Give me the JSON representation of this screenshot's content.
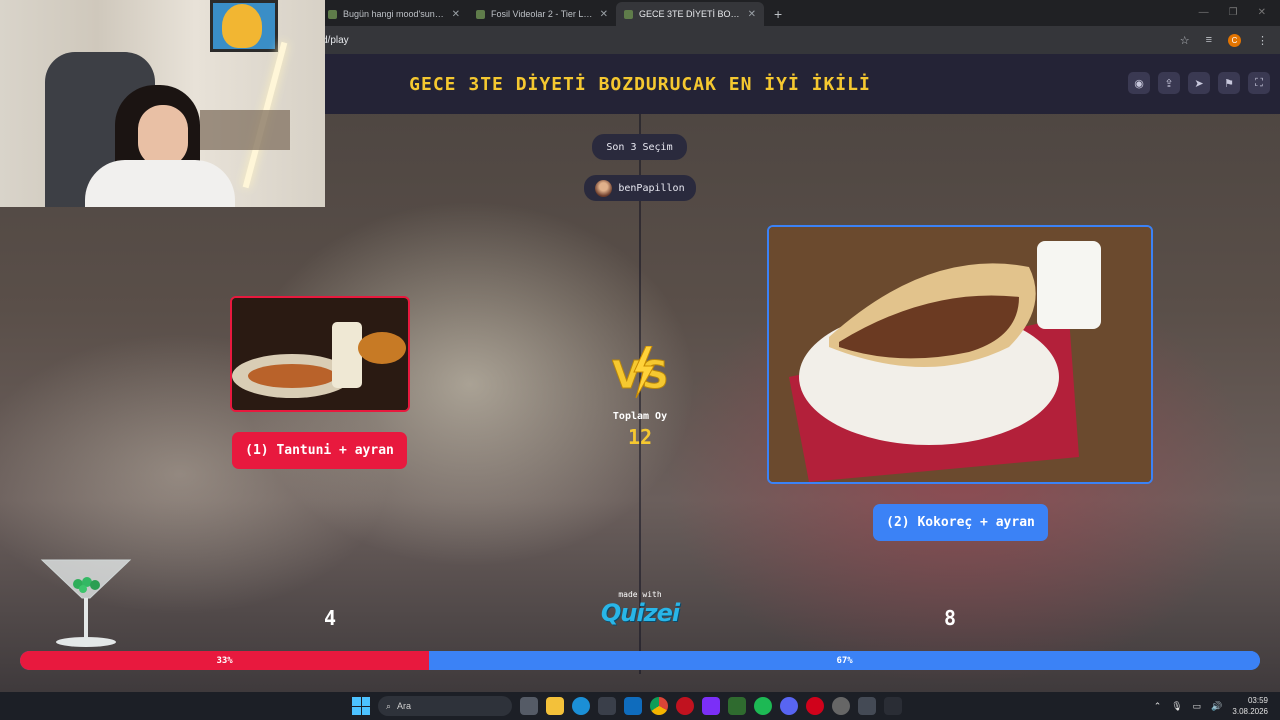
{
  "browser": {
    "tabs": [
      {
        "label": "Bugün hangi mood'sun? - Tier",
        "active": false
      },
      {
        "label": "Fosil Videolar 2 - Tier List | Kör",
        "active": false
      },
      {
        "label": "GECE 3TE DİYETİ BOZDURUCAK",
        "active": true
      }
    ],
    "new_tab": "+",
    "address": "d/play",
    "profile_initial": "C"
  },
  "quiz": {
    "title": "GECE 3TE DİYETİ BOZDURUCAK EN İYİ İKİLİ",
    "recent_label": "Son 3 Seçim",
    "recent_user": "benPapillon",
    "option_left": "(1) Tantuni + ayran",
    "option_right": "(2) Kokoreç + ayran",
    "total_label": "Toplam Oy",
    "total_votes": "12",
    "votes_left": "4",
    "votes_right": "8",
    "percent_left": "33%",
    "percent_right": "67%",
    "share_left": 0.33,
    "made_with": "made with",
    "brand": "Quizei",
    "colors": {
      "left": "#e8193e",
      "right": "#3b82f6",
      "accent": "#f5c830",
      "header": "#242336"
    }
  },
  "taskbar": {
    "search_placeholder": "Ara",
    "time": "03:59",
    "date": "3.08.2026"
  }
}
